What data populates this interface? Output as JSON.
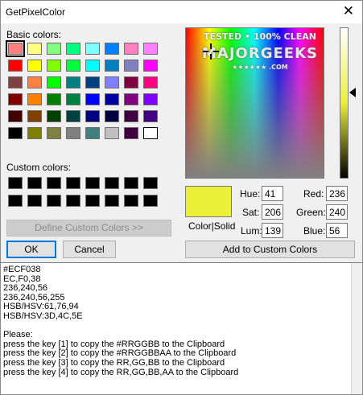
{
  "window": {
    "title": "GetPixelColor",
    "close_symbol": "✕"
  },
  "basic": {
    "label": "Basic colors:",
    "colors": [
      "#ff8080",
      "#ffff80",
      "#80ff80",
      "#00ff80",
      "#80ffff",
      "#0080ff",
      "#ff80c0",
      "#ff80ff",
      "#ff0000",
      "#ffff00",
      "#80ff00",
      "#00ff40",
      "#00ffff",
      "#0080c0",
      "#8080c0",
      "#ff00ff",
      "#804040",
      "#ff8040",
      "#00ff00",
      "#008080",
      "#004080",
      "#8080ff",
      "#800040",
      "#ff0080",
      "#800000",
      "#ff8000",
      "#008000",
      "#008040",
      "#0000ff",
      "#0000a0",
      "#800080",
      "#8000ff",
      "#400000",
      "#804000",
      "#004000",
      "#004040",
      "#000080",
      "#000040",
      "#400040",
      "#400080",
      "#000000",
      "#808000",
      "#808040",
      "#808080",
      "#408080",
      "#c0c0c0",
      "#400040",
      "#ffffff"
    ],
    "selected_index": 0
  },
  "custom": {
    "label": "Custom colors:",
    "colors": [
      "#000000",
      "#000000",
      "#000000",
      "#000000",
      "#000000",
      "#000000",
      "#000000",
      "#000000",
      "#000000",
      "#000000",
      "#000000",
      "#000000",
      "#000000",
      "#000000",
      "#000000",
      "#000000"
    ]
  },
  "buttons": {
    "define_custom": "Define Custom Colors >>",
    "ok": "OK",
    "cancel": "Cancel",
    "add_custom": "Add to Custom Colors"
  },
  "spectrum": {
    "watermark_line1": "TESTED • 100% CLEAN",
    "watermark_line2": "MAJORGEEKS",
    "watermark_line3": "★★★★★★ .COM"
  },
  "current_color": "#ecf038",
  "color_solid_label": "Color|Solid",
  "fields": {
    "hue_label": "Hue:",
    "hue": "41",
    "sat_label": "Sat:",
    "sat": "206",
    "lum_label": "Lum:",
    "lum": "139",
    "red_label": "Red:",
    "red": "236",
    "green_label": "Green:",
    "green": "240",
    "blue_label": "Blue:",
    "blue": "56"
  },
  "output_lines": [
    "#ECF038",
    "EC,F0,38",
    "236,240,56",
    "236,240,56,255",
    "HSB/HSV:61,76,94",
    "HSB/HSV:3D,4C,5E",
    "",
    "Please:",
    "press the key [1] to copy the #RRGGBB to the Clipboard",
    "press the key [2] to copy the #RRGGBBAA to the Clipboard",
    "press the key [3] to copy the RR,GG,BB to the Clipboard",
    "press the key [4] to copy the RR,GG,BB,AA to the Clipboard"
  ]
}
